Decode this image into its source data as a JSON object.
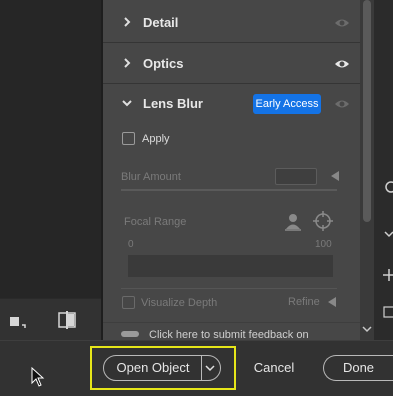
{
  "panel": {
    "sections": {
      "detail": {
        "label": "Detail"
      },
      "optics": {
        "label": "Optics"
      },
      "lens_blur": {
        "label": "Lens Blur",
        "badge": "Early Access"
      }
    },
    "lens_blur": {
      "apply_label": "Apply",
      "blur_amount_label": "Blur Amount",
      "focal_range_label": "Focal Range",
      "focal_min": "0",
      "focal_max": "100",
      "visualize_depth_label": "Visualize Depth",
      "refine_label": "Refine",
      "feedback_text": "Click here to submit feedback on"
    }
  },
  "bottom_bar": {
    "open_object_label": "Open Object",
    "cancel_label": "Cancel",
    "done_label": "Done"
  },
  "icons": {
    "crop": "crop-icon",
    "compare": "compare-icon",
    "eye": "eye-icon",
    "target": "target-icon",
    "person": "person-icon"
  },
  "colors": {
    "accent_badge": "#1473e6",
    "highlight": "#e6e619",
    "panel_bg": "#474747",
    "app_bg": "#323232"
  }
}
